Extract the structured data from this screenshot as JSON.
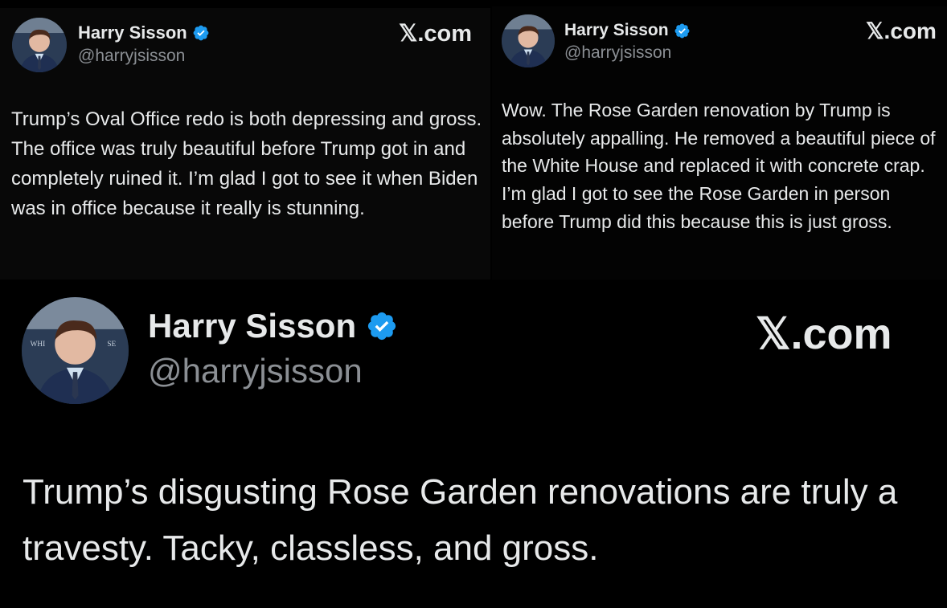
{
  "colors": {
    "background": "#000000",
    "text": "#e7e9ea",
    "handle": "#8b8f94",
    "verified": "#1d9bf0"
  },
  "tweets": [
    {
      "author_name": "Harry Sisson",
      "handle": "@harryjsisson",
      "verified_icon": "verified-badge-icon",
      "brand": "𝕏.com",
      "text": "Trump’s Oval Office redo is both depressing and gross. The office was truly beautiful before Trump got in and completely ruined it. I’m glad I got to see it when Biden was in office because it really is stunning."
    },
    {
      "author_name": "Harry Sisson",
      "handle": "@harryjsisson",
      "verified_icon": "verified-badge-icon",
      "brand": "𝕏.com",
      "text": "Wow. The Rose Garden renovation by Trump is absolutely appalling. He removed a beautiful piece of the White House and replaced it with concrete crap. I’m glad I got to see the Rose Garden in person before Trump did this because this is just gross."
    },
    {
      "author_name": "Harry Sisson",
      "handle": "@harryjsisson",
      "verified_icon": "verified-badge-icon",
      "brand": "𝕏.com",
      "text": "Trump’s disgusting Rose Garden renovations are truly a travesty. Tacky, classless, and gross."
    }
  ]
}
